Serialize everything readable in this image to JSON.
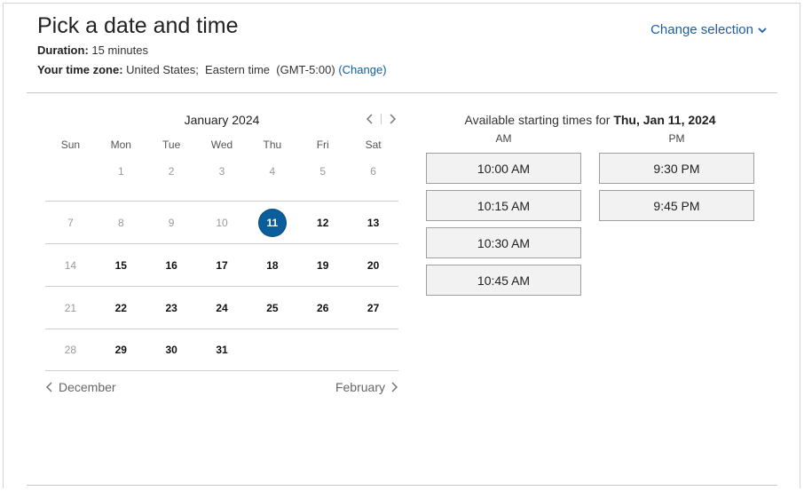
{
  "header": {
    "title": "Pick a date and time",
    "duration_label": "Duration:",
    "duration_value": "15 minutes",
    "timezone_label": "Your time zone:",
    "timezone_value": "United States;  Eastern time  (GMT-5:00)",
    "change_link": "(Change)",
    "change_selection": "Change selection"
  },
  "calendar": {
    "month_label": "January 2024",
    "weekdays": [
      "Sun",
      "Mon",
      "Tue",
      "Wed",
      "Thu",
      "Fri",
      "Sat"
    ],
    "weeks": [
      [
        {
          "d": "",
          "s": "empty"
        },
        {
          "d": "1",
          "s": "muted"
        },
        {
          "d": "2",
          "s": "muted"
        },
        {
          "d": "3",
          "s": "muted"
        },
        {
          "d": "4",
          "s": "muted"
        },
        {
          "d": "5",
          "s": "muted"
        },
        {
          "d": "6",
          "s": "muted"
        }
      ],
      [
        {
          "d": "7",
          "s": "muted"
        },
        {
          "d": "8",
          "s": "muted"
        },
        {
          "d": "9",
          "s": "muted"
        },
        {
          "d": "10",
          "s": "muted"
        },
        {
          "d": "11",
          "s": "selected"
        },
        {
          "d": "12",
          "s": "avail"
        },
        {
          "d": "13",
          "s": "avail"
        }
      ],
      [
        {
          "d": "14",
          "s": "muted"
        },
        {
          "d": "15",
          "s": "avail"
        },
        {
          "d": "16",
          "s": "avail"
        },
        {
          "d": "17",
          "s": "avail"
        },
        {
          "d": "18",
          "s": "avail"
        },
        {
          "d": "19",
          "s": "avail"
        },
        {
          "d": "20",
          "s": "avail"
        }
      ],
      [
        {
          "d": "21",
          "s": "muted"
        },
        {
          "d": "22",
          "s": "avail"
        },
        {
          "d": "23",
          "s": "avail"
        },
        {
          "d": "24",
          "s": "avail"
        },
        {
          "d": "25",
          "s": "avail"
        },
        {
          "d": "26",
          "s": "avail"
        },
        {
          "d": "27",
          "s": "avail"
        }
      ],
      [
        {
          "d": "28",
          "s": "muted"
        },
        {
          "d": "29",
          "s": "avail"
        },
        {
          "d": "30",
          "s": "avail"
        },
        {
          "d": "31",
          "s": "avail"
        },
        {
          "d": "",
          "s": "empty"
        },
        {
          "d": "",
          "s": "empty"
        },
        {
          "d": "",
          "s": "empty"
        }
      ]
    ],
    "prev_month": "December",
    "next_month": "February"
  },
  "times": {
    "title_prefix": "Available starting times for",
    "selected_date": "Thu, Jan 11, 2024",
    "am_label": "AM",
    "pm_label": "PM",
    "am_slots": [
      "10:00 AM",
      "10:15 AM",
      "10:30 AM",
      "10:45 AM"
    ],
    "pm_slots": [
      "9:30 PM",
      "9:45 PM"
    ]
  },
  "colors": {
    "accent": "#0b5e9c",
    "link": "#1d5fa0",
    "slot_bg": "#f2f2f2",
    "slot_border": "#9e9e9e"
  },
  "icons": [
    "chevron-down-icon",
    "chevron-left-icon",
    "chevron-right-icon"
  ]
}
